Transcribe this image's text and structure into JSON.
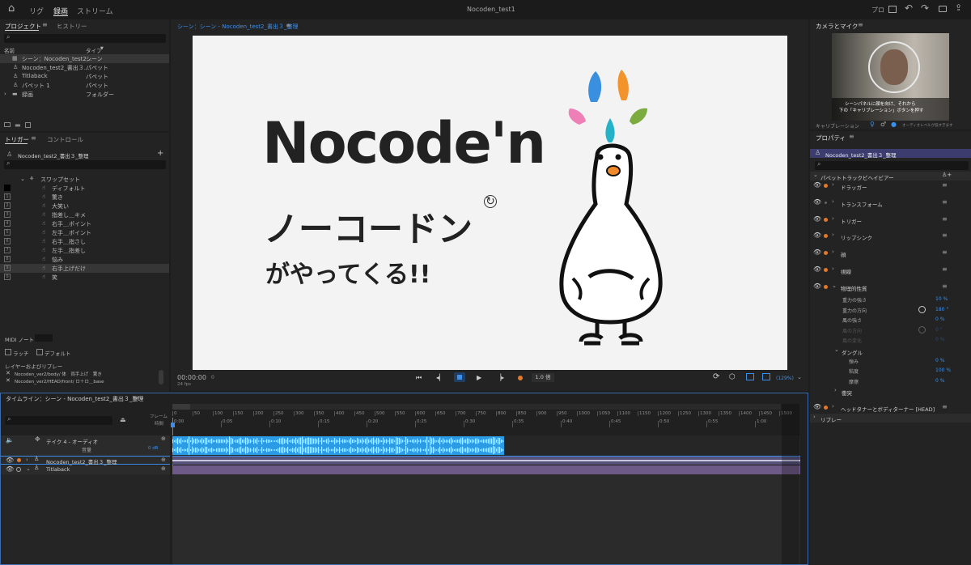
{
  "topbar": {
    "home": "⌂",
    "tabs": [
      "リグ",
      "録画",
      "ストリーム"
    ],
    "active_tab": 1,
    "title": "Nocoden_test1",
    "right_label": "プロ"
  },
  "project": {
    "tabs": [
      "プロジェクト",
      "ヒストリー"
    ],
    "col_name": "名前",
    "col_type": "タイプ",
    "sort": "▼",
    "items": [
      {
        "name": "シーン：Nocoden_test2...",
        "type": "シーン",
        "selected": true
      },
      {
        "name": "Nocoden_test2_書出３...",
        "type": "パペット"
      },
      {
        "name": "Titlaback",
        "type": "パペット"
      },
      {
        "name": "パペット 1",
        "type": "パペット"
      },
      {
        "name": "録画",
        "type": "フォルダー"
      }
    ]
  },
  "triggers": {
    "tabs": [
      "トリガー",
      "コントロール"
    ],
    "puppet": "Nocoden_test2_書出３_整理",
    "swapset": "スワップセット",
    "items": [
      {
        "num": "",
        "label": "ディフォルト"
      },
      {
        "num": "1",
        "label": "驚き"
      },
      {
        "num": "2",
        "label": "大笑い"
      },
      {
        "num": "3",
        "label": "指差し＿キメ"
      },
      {
        "num": "4",
        "label": "右手＿ポイント"
      },
      {
        "num": "5",
        "label": "左手＿ポイント"
      },
      {
        "num": "6",
        "label": "右手＿指さし"
      },
      {
        "num": "7",
        "label": "左手＿指差し"
      },
      {
        "num": "8",
        "label": "悩み"
      },
      {
        "num": "9",
        "label": "右手上げだけ",
        "selected": true
      },
      {
        "num": "0",
        "label": "笑"
      }
    ],
    "midi": "MIDI ノート",
    "latch": "ラッチ",
    "default": "デフォルト",
    "layer_replay": "レイヤーおよびリプレー",
    "layers": [
      "Nocoden_ver2/body/ 体　両手上げ　驚き",
      "Nocoden_ver2/HEAD/front/ ロ＋ロ＿base"
    ]
  },
  "scene": {
    "header": "シーン：シーン - Nocoden_test2_書出３_整理",
    "timecode": "00:00:00",
    "frame": "0",
    "fps": "24 fps",
    "speed": "1.0 倍",
    "zoom": "(129%)",
    "art": {
      "title": "Nocode'n",
      "line2": "ノーコードン",
      "line3": "がやってくる!!",
      "mark": "↻"
    }
  },
  "camera": {
    "title": "カメラとマイク",
    "msg1": "シーンパネルに顔を向け、それから",
    "msg2": "下の「キャリブレーション」ボタンを押す",
    "calibrate": "キャリブレーション",
    "audio_note": "オーディオレベルが低すぎます"
  },
  "properties": {
    "title": "プロパティ",
    "puppet": "Nocoden_test2_書出３_整理",
    "section": "パペットトラックビヘイビアー",
    "behaviors": [
      "ドラッガー",
      "トランスフォーム",
      "トリガー",
      "リップシンク",
      "顔",
      "視線",
      "物理的性質"
    ],
    "params": [
      {
        "label": "重力の強さ",
        "value": "10 %"
      },
      {
        "label": "重力の方向",
        "value": "180 °",
        "dial": true
      },
      {
        "label": "風の強さ",
        "value": "0 %"
      },
      {
        "label": "風の方向",
        "value": "0 °",
        "dial": true,
        "dim": true
      },
      {
        "label": "風の変化",
        "value": "0 %",
        "dim": true
      }
    ],
    "dangle": "ダングル",
    "dangle_params": [
      {
        "label": "弾み",
        "value": "0 %"
      },
      {
        "label": "粘度",
        "value": "100 %"
      },
      {
        "label": "摩擦",
        "value": "0 %"
      }
    ],
    "collision": "衝突",
    "head_behavior": "ヘッドタナーとボディターナー [HEAD]",
    "replay": "リプレー"
  },
  "timeline": {
    "header": "タイムライン：シーン - Nocoden_test2_書出３_整理",
    "frame_label": "フレーム",
    "time_label": "時間",
    "frames": [
      "0",
      "50",
      "100",
      "150",
      "200",
      "250",
      "300",
      "350",
      "400",
      "450",
      "500",
      "550",
      "600",
      "650",
      "700",
      "750",
      "800",
      "850",
      "900",
      "950",
      "1000",
      "1050",
      "1100",
      "1150",
      "1200",
      "1250",
      "1300",
      "1350",
      "1400",
      "1450",
      "1500"
    ],
    "times": [
      "0:00",
      "0:05",
      "0:10",
      "0:15",
      "0:20",
      "0:25",
      "0:30",
      "0:35",
      "0:40",
      "0:45",
      "0:50",
      "0:55",
      "1:00",
      "1:05"
    ],
    "tracks": [
      {
        "name": "テイク 4 - オーディオ",
        "sub": "音量",
        "db": "0 dB"
      },
      {
        "name": "Nocoden_test2_書出３_整理"
      },
      {
        "name": "Titlaback"
      }
    ]
  }
}
